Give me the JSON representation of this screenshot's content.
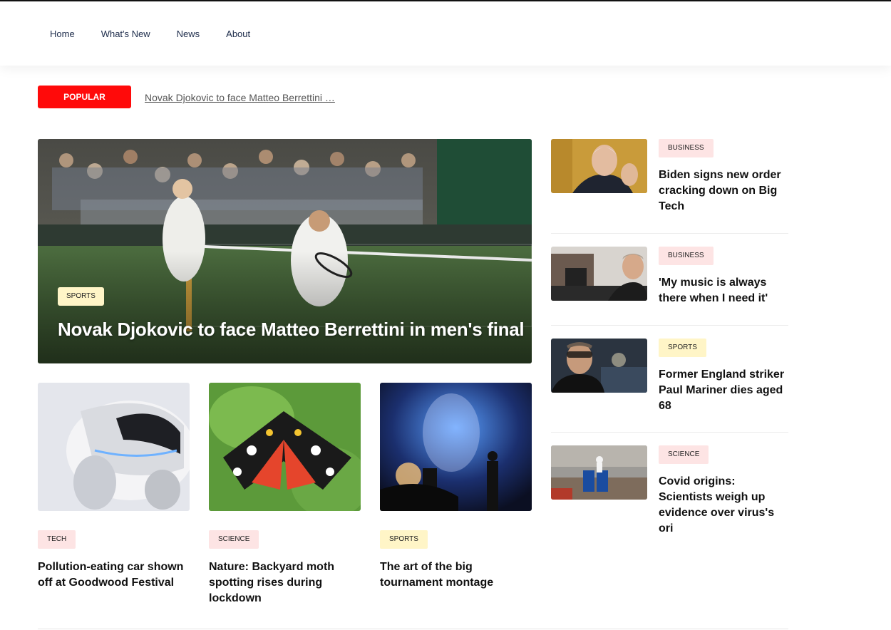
{
  "nav": {
    "items": [
      "Home",
      "What's New",
      "News",
      "About"
    ]
  },
  "popular": {
    "label": "POPULAR",
    "ticker": "Novak Djokovic to face Matteo Berrettini …"
  },
  "hero": {
    "tag": "SPORTS",
    "title": "Novak Djokovic to face Matteo Berrettini in men's final"
  },
  "cards": [
    {
      "tag": "TECH",
      "title": "Pollution-eating car shown off at Goodwood Festival"
    },
    {
      "tag": "SCIENCE",
      "title": "Nature: Backyard moth spotting rises during lockdown"
    },
    {
      "tag": "SPORTS",
      "title": "The art of the big tournament montage"
    }
  ],
  "sidebar": [
    {
      "tag": "BUSINESS",
      "title": "Biden signs new order cracking down on Big Tech"
    },
    {
      "tag": "BUSINESS",
      "title": "'My music is always there when I need it'"
    },
    {
      "tag": "SPORTS",
      "title": "Former England striker Paul Mariner dies aged 68"
    },
    {
      "tag": "SCIENCE",
      "title": "Covid origins: Scientists weigh up evidence over virus's ori"
    }
  ],
  "colors": {
    "popular": "#ff0a0a",
    "tag_pink": "#fde4e4",
    "tag_yellow": "#fff5c7",
    "nav_text": "#1c2b4a"
  }
}
